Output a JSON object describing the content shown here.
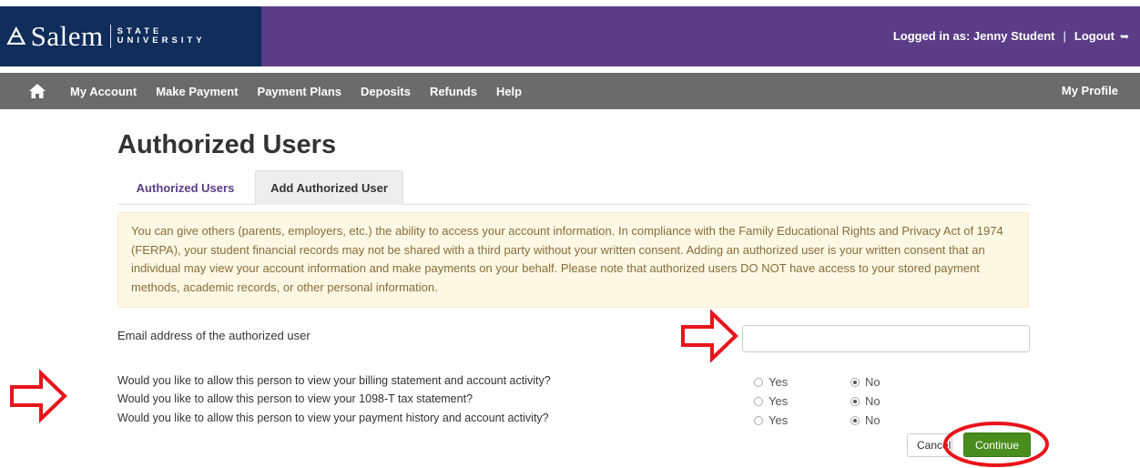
{
  "header": {
    "logo_word": "Salem",
    "logo_sub_1": "STATE",
    "logo_sub_2": "UNIVERSITY",
    "logged_in": "Logged in as: Jenny Student",
    "separator": "|",
    "logout": "Logout"
  },
  "nav": {
    "items": [
      "My Account",
      "Make Payment",
      "Payment Plans",
      "Deposits",
      "Refunds",
      "Help"
    ],
    "right": "My Profile"
  },
  "page": {
    "title": "Authorized Users",
    "tabs": [
      {
        "label": "Authorized Users"
      },
      {
        "label": "Add Authorized User"
      }
    ],
    "notice": "You can give others (parents, employers, etc.) the ability to access your account information. In compliance with the Family Educational Rights and Privacy Act of 1974 (FERPA), your student financial records may not be shared with a third party without your written consent. Adding an authorized user is your written consent that an individual may view your account information and make payments on your behalf. Please note that authorized users DO NOT have access to your stored payment methods, academic records, or other personal information."
  },
  "form": {
    "email_label": "Email address of the authorized user",
    "email_value": "",
    "questions": [
      {
        "text": "Would you like to allow this person to view your billing statement and account activity?",
        "yes": "Yes",
        "no": "No",
        "selected": "No"
      },
      {
        "text": "Would you like to allow this person to view your 1098-T tax statement?",
        "yes": "Yes",
        "no": "No",
        "selected": "No"
      },
      {
        "text": "Would you like to allow this person to view your payment history and account activity?",
        "yes": "Yes",
        "no": "No",
        "selected": "No"
      }
    ],
    "cancel_label": "Cancel",
    "continue_label": "Continue"
  },
  "colors": {
    "header_purple": "#5a3d86",
    "logo_navy": "#102d5b",
    "nav_gray": "#6b6b6b",
    "alert_bg": "#fcf8e3",
    "alert_text": "#8a6d3b",
    "continue_green": "#4a8d1f",
    "annotation_red": "#e8141a"
  }
}
